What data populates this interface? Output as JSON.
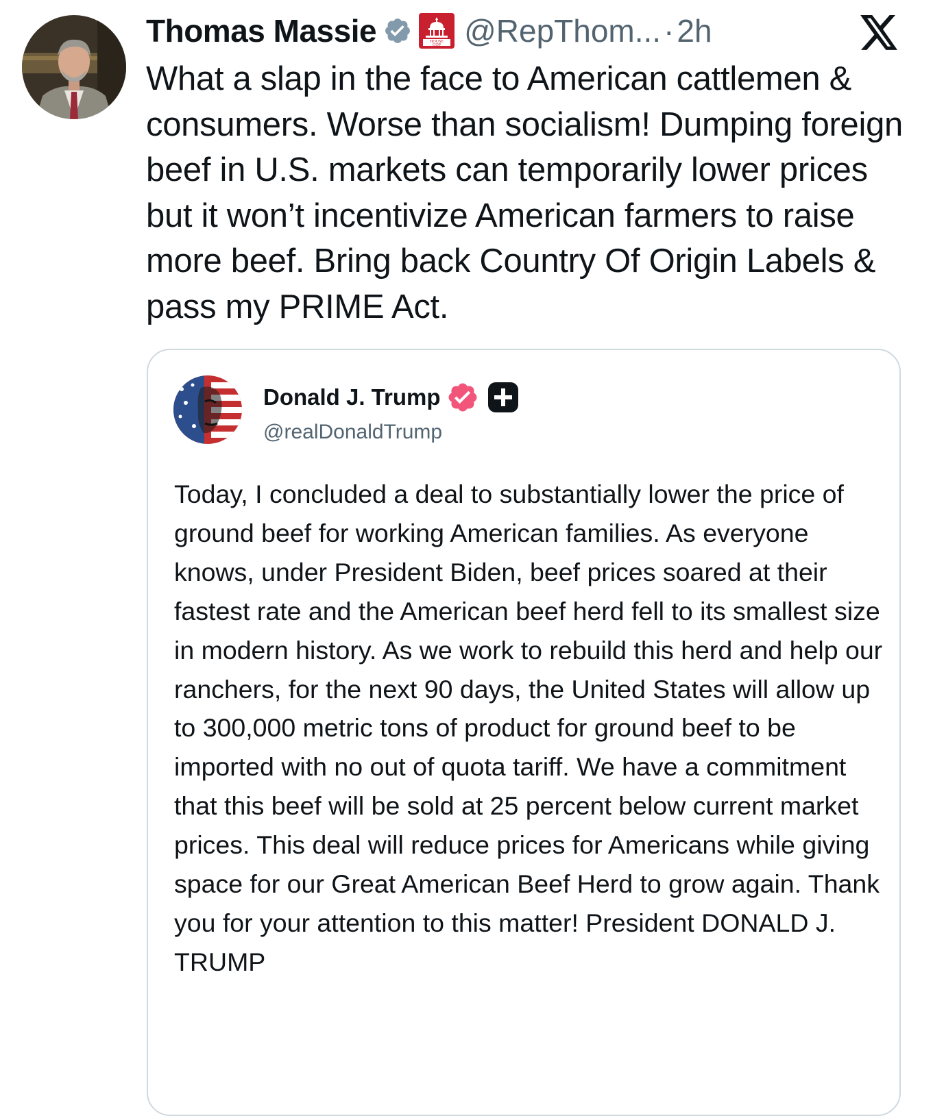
{
  "post": {
    "author_name": "Thomas Massie",
    "handle": "@RepThom...",
    "separator": "·",
    "timestamp": "2h",
    "affiliation_badge": "HOUSE GOP",
    "text": "What a slap in the face to American cattlemen & consumers. Worse than socialism! Dumping foreign beef in U.S. markets can temporarily lower prices but it won’t incentivize American farmers to raise more beef. Bring back Country Of Origin Labels & pass my PRIME Act."
  },
  "quoted_post": {
    "author_name": "Donald J. Trump",
    "handle": "@realDonaldTrump",
    "text": "Today, I concluded a deal to substantially lower the price of ground beef for working American families. As everyone knows, under President Biden, beef prices soared at their fastest rate and the American beef herd fell to its smallest size in modern history. As we work to rebuild this herd and help our ranchers, for the next 90 days, the United States will allow up to 300,000 metric tons of product for ground beef to be imported with no out of quota tariff. We have a commitment that this beef will be sold at 25 percent below current market prices. This deal will reduce prices for Americans while giving space for our Great American Beef Herd to grow again. Thank you for your attention to this matter! President DONALD J. TRUMP"
  },
  "icons": {
    "verified": "verified-badge-icon",
    "affiliation": "house-gop-capitol-icon",
    "platform": "x-logo-icon",
    "quoted_verified": "verified-badge-icon",
    "quoted_plus": "plus-badge-icon"
  },
  "colors": {
    "text": "#0f1419",
    "secondary_text": "#536471",
    "verified_blue": "#829aab",
    "quoted_verified_pink": "#f2557a",
    "affiliation_red": "#c8202f",
    "card_border": "#cfd9de"
  }
}
